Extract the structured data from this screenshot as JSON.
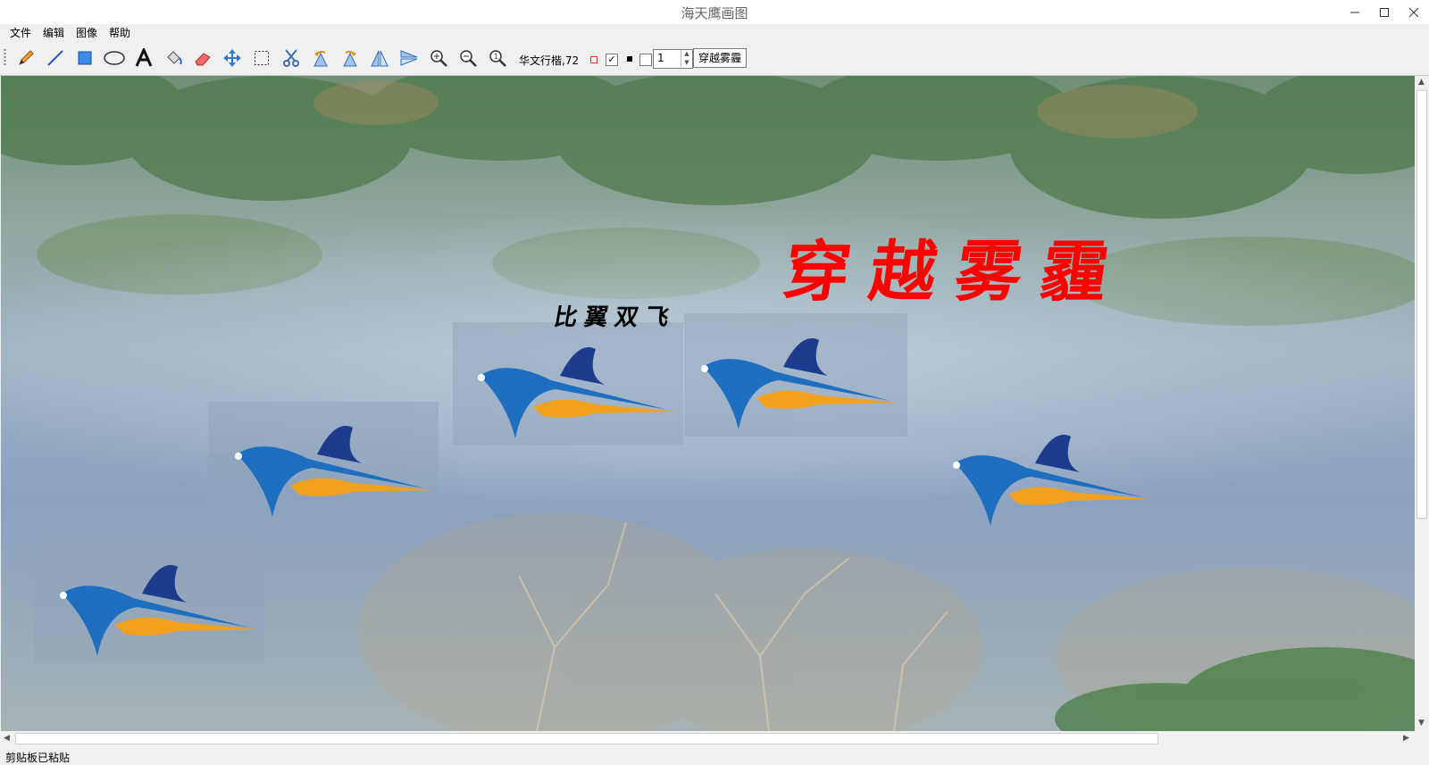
{
  "window": {
    "title": "海天鹰画图"
  },
  "menu": {
    "items": [
      "文件",
      "编辑",
      "图像",
      "帮助"
    ]
  },
  "toolbar": {
    "font_label": "华文行楷,72",
    "border_checked": "✓",
    "line_width": "1",
    "text_button_label": "穿越雾霾",
    "tools": [
      "pencil-icon",
      "line-icon",
      "rectangle-icon",
      "ellipse-icon",
      "text-icon",
      "fill-bucket-icon",
      "eraser-icon",
      "move-icon",
      "select-icon",
      "cut-icon",
      "rotate-left-icon",
      "rotate-right-icon",
      "flip-horizontal-icon",
      "flip-vertical-icon",
      "zoom-in-icon",
      "zoom-out-icon",
      "zoom-original-icon"
    ]
  },
  "canvas": {
    "title_text": "穿越雾霾",
    "caption_text": "比翼双飞",
    "title_color": "#ff0000",
    "caption_color": "#000000"
  },
  "status": {
    "text": "剪贴板已粘贴"
  }
}
